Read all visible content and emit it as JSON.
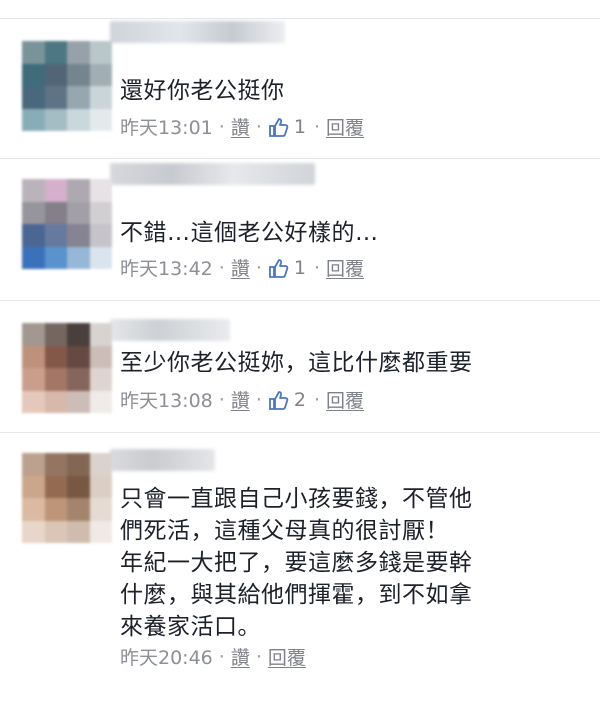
{
  "comments": [
    {
      "text": "還好你老公挺你",
      "time": "昨天13:01",
      "like_label": "讚",
      "like_count": "1",
      "reply_label": "回覆",
      "avatar_colors": [
        "#6f8a92",
        "#3f6c7a",
        "#8e9aa3",
        "#b4c2c6",
        "#2f5f70",
        "#43596b",
        "#6a7b87",
        "#9aa8ae",
        "#3a5c72",
        "#51697c",
        "#8ea0aa",
        "#c5d2d6",
        "#7fa7b2",
        "#9db8c0",
        "#c4d5da",
        "#e1e9eb"
      ]
    },
    {
      "text": "不錯…這個老公好樣的…",
      "time": "昨天13:42",
      "like_label": "讚",
      "like_count": "1",
      "reply_label": "回覆",
      "avatar_colors": [
        "#b6adb6",
        "#d2a9c8",
        "#a8a2ab",
        "#e4e0e4",
        "#8e8d95",
        "#7a7580",
        "#9b97a0",
        "#cfcbd0",
        "#3d5a8c",
        "#5a6f98",
        "#7c7a8a",
        "#c2bfc6",
        "#2b66b5",
        "#4b89c9",
        "#8fb1d6",
        "#d6e2ee"
      ]
    },
    {
      "text": "至少你老公挺妳，這比什麼都重要",
      "time": "昨天13:08",
      "like_label": "讚",
      "like_count": "2",
      "reply_label": "回覆",
      "avatar_colors": [
        "#9b8f88",
        "#6a5a52",
        "#3a2f2c",
        "#d5d0ce",
        "#b98871",
        "#7a4a3a",
        "#5a3a33",
        "#c9b8b2",
        "#c79683",
        "#9c6b59",
        "#7c5a4f",
        "#ddd2cd",
        "#e2c4b6",
        "#d5b2a3",
        "#c8b8b2",
        "#eeeae8"
      ]
    },
    {
      "text": "只會一直跟自己小孩要錢，不管他\n們死活，這種父母真的很討厭！\n年紀一大把了，要這麼多錢是要幹\n什麼，與其給他們揮霍，到不如拿\n來養家活口。",
      "time": "昨天20:46",
      "like_label": "讚",
      "like_count": "",
      "reply_label": "回覆",
      "avatar_colors": [
        "#b79a86",
        "#8a6a55",
        "#7a5a47",
        "#d8cfc8",
        "#c79f82",
        "#8c5f42",
        "#6e4a34",
        "#d9cbc1",
        "#d8b49b",
        "#b98d6e",
        "#9e7a62",
        "#e4d8d0",
        "#e6d3c5",
        "#d9c1b0",
        "#cdb7a8",
        "#f0e8e3"
      ]
    }
  ]
}
